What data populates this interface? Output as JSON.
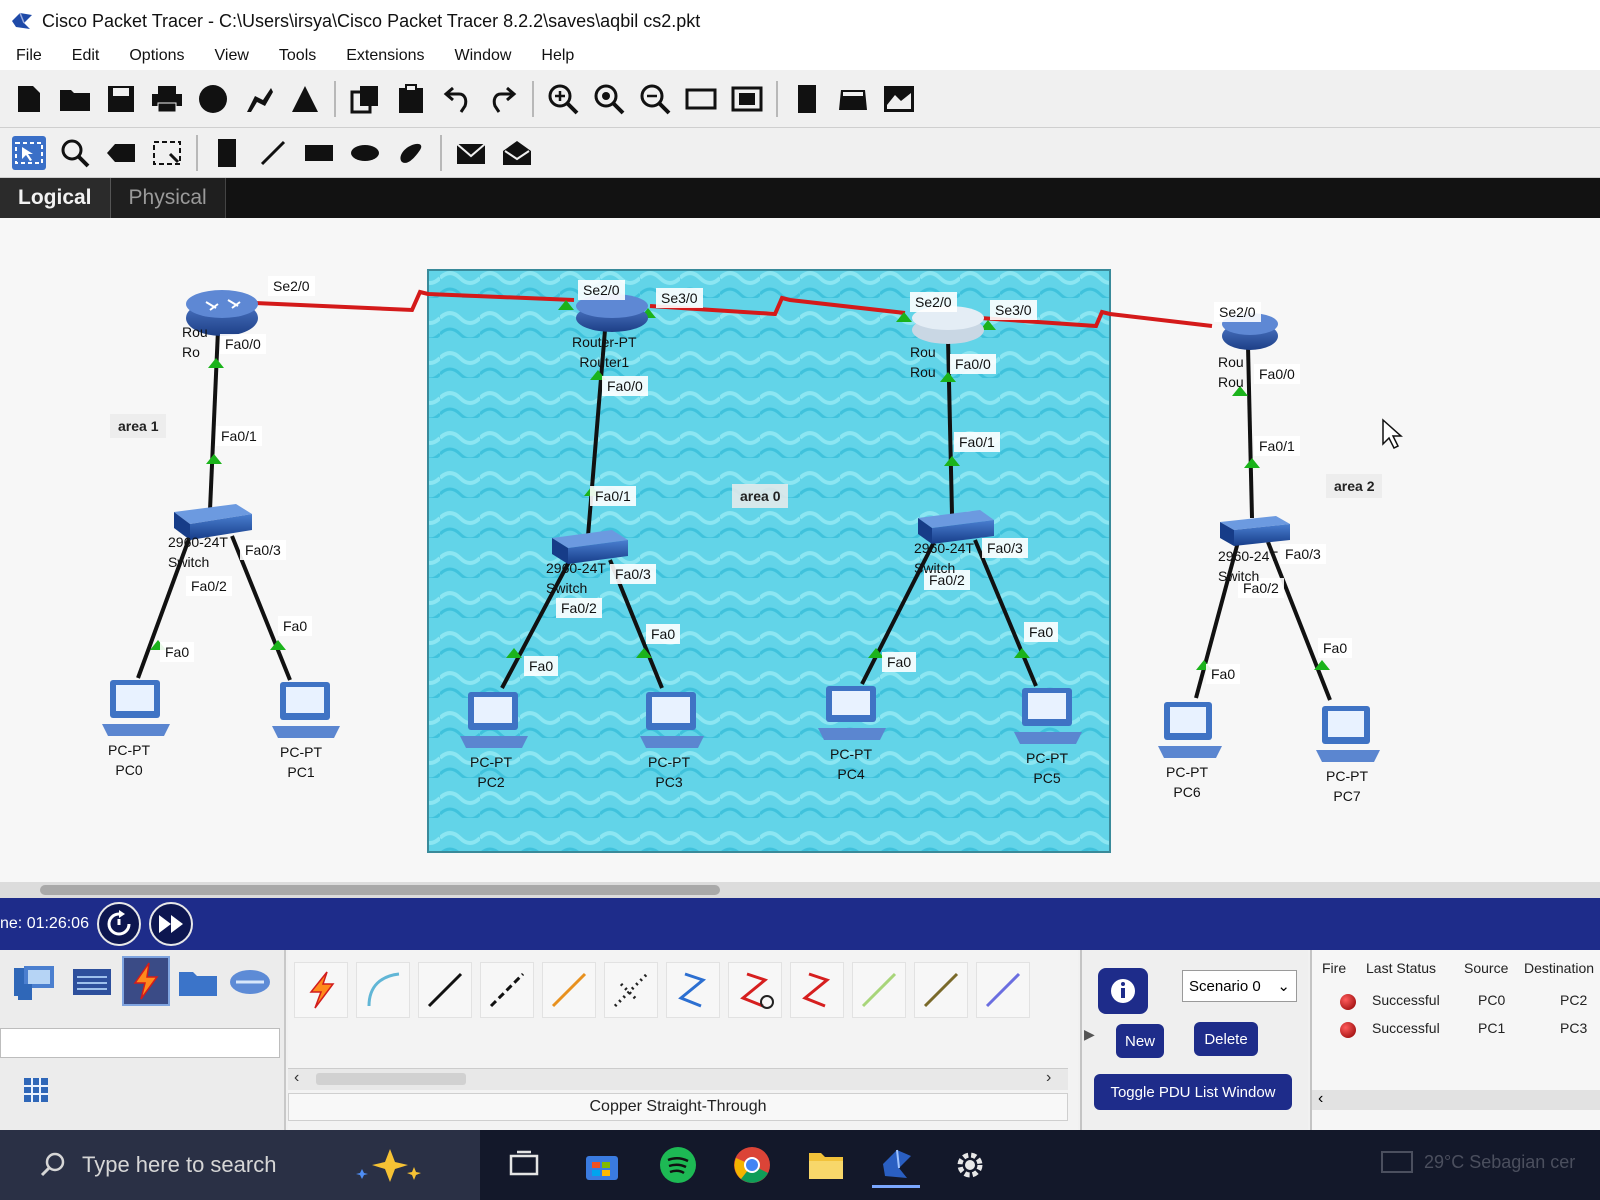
{
  "window": {
    "title": "Cisco Packet Tracer - C:\\Users\\irsya\\Cisco Packet Tracer 8.2.2\\saves\\aqbil cs2.pkt"
  },
  "menu": [
    "File",
    "Edit",
    "Options",
    "View",
    "Tools",
    "Extensions",
    "Window",
    "Help"
  ],
  "toolbar1_icons": [
    "new-file-icon",
    "open-folder-icon",
    "save-icon",
    "print-icon",
    "activity-wizard-icon",
    "network-info-icon",
    "custom-device-icon",
    "copy-icon",
    "paste-icon",
    "undo-icon",
    "redo-icon",
    "zoom-in-icon",
    "zoom-reset-icon",
    "zoom-out-icon",
    "drawing-palette-icon",
    "custom-device-dialog-icon",
    "cluster-icon",
    "viewport-icon",
    "simulation-view-icon"
  ],
  "toolbar2_icons": [
    "select-icon",
    "inspect-icon",
    "delete-icon",
    "resize-icon",
    "note-icon",
    "line-draw-icon",
    "rectangle-icon",
    "ellipse-icon",
    "freeform-icon",
    "simple-pdu-icon",
    "complex-pdu-icon"
  ],
  "views": {
    "logical": "Logical",
    "physical": "Physical"
  },
  "topology": {
    "areas": [
      {
        "id": "area1",
        "label": "area 1"
      },
      {
        "id": "area0",
        "label": "area 0"
      },
      {
        "id": "area2",
        "label": "area 2"
      }
    ],
    "routers": [
      {
        "name": "Router0",
        "label1": "Rou",
        "label2": "Ro"
      },
      {
        "name": "Router1",
        "label1": "Router-PT",
        "label2": "Router1"
      },
      {
        "name": "Router2",
        "label1": "Rou",
        "label2": "Rou"
      },
      {
        "name": "Router3",
        "label1": "Rou",
        "label2": "Rou"
      }
    ],
    "switches": [
      {
        "name": "Switch0",
        "label1": "2960-24T",
        "label2": "Switch"
      },
      {
        "name": "Switch1",
        "label1": "2960-24T",
        "label2": "Switch"
      },
      {
        "name": "Switch2",
        "label1": "2960-24T",
        "label2": "Switch"
      },
      {
        "name": "Switch3",
        "label1": "2960-24T",
        "label2": "Switch"
      }
    ],
    "pcs": [
      {
        "type": "PC-PT",
        "name": "PC0"
      },
      {
        "type": "PC-PT",
        "name": "PC1"
      },
      {
        "type": "PC-PT",
        "name": "PC2"
      },
      {
        "type": "PC-PT",
        "name": "PC3"
      },
      {
        "type": "PC-PT",
        "name": "PC4"
      },
      {
        "type": "PC-PT",
        "name": "PC5"
      },
      {
        "type": "PC-PT",
        "name": "PC6"
      },
      {
        "type": "PC-PT",
        "name": "PC7"
      }
    ],
    "ports": {
      "se20": "Se2/0",
      "se30": "Se3/0",
      "fa00": "Fa0/0",
      "fa01": "Fa0/1",
      "fa01b": "Fa0/1",
      "fa02": "Fa0/2",
      "fa03": "Fa0/3",
      "fa0": "Fa0"
    },
    "colors": {
      "serial": "#d41a1a",
      "ethernet": "#111111",
      "link_up": "#1bb31b",
      "area0_fill": "#5fd2e6"
    }
  },
  "realtime": {
    "time": "ne: 01:26:06"
  },
  "device_categories": [
    "end-devices-icon",
    "components-icon",
    "network-devices-icon",
    "connections-icon",
    "misc-icon",
    "multiuser-icon",
    "grid-icon"
  ],
  "connection_tools": [
    "auto-connection-icon",
    "console-cable-icon",
    "copper-straight-through-icon",
    "copper-cross-over-icon",
    "fiber-icon",
    "phone-cable-icon",
    "coaxial-icon",
    "serial-dce-icon",
    "serial-dte-icon",
    "octal-cable-icon",
    "iot-custom-cable-icon",
    "usb-cable-icon"
  ],
  "selected_connection": "Copper Straight-Through",
  "scenario": {
    "selected": "Scenario 0",
    "new_label": "New",
    "delete_label": "Delete",
    "toggle_label": "Toggle PDU List Window"
  },
  "pdu_list": {
    "headers": [
      "Fire",
      "Last Status",
      "Source",
      "Destination"
    ],
    "rows": [
      {
        "status": "Successful",
        "source": "PC0",
        "destination": "PC2"
      },
      {
        "status": "Successful",
        "source": "PC1",
        "destination": "PC3"
      }
    ]
  },
  "taskbar": {
    "search_placeholder": "Type here to search",
    "weather": "29°C  Sebagian cer"
  }
}
